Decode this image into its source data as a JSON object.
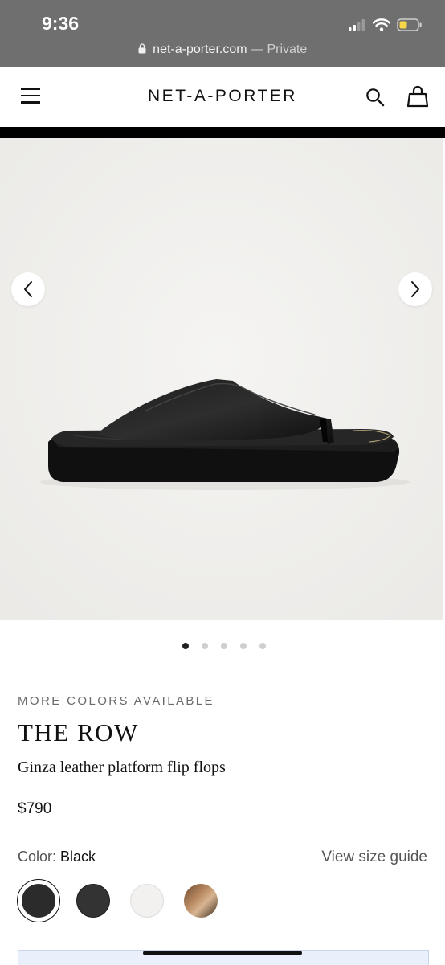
{
  "status_bar": {
    "time": "9:36",
    "url": "net-a-porter.com",
    "private_label": "— Private"
  },
  "header": {
    "brand": "NET-A-PORTER"
  },
  "icons": {
    "menu": "hamburger-menu-icon",
    "search": "search-icon",
    "bag": "shopping-bag-icon",
    "prev": "chevron-left-icon",
    "next": "chevron-right-icon",
    "lock": "lock-icon"
  },
  "gallery": {
    "image_count": 5,
    "active_index": 0
  },
  "product": {
    "more_colors": "MORE COLORS AVAILABLE",
    "designer": "THE ROW",
    "name": "Ginza leather platform flip flops",
    "price": "$790",
    "color_label": "Color:",
    "color_value": "Black",
    "size_guide": "View size guide",
    "swatches": [
      {
        "name": "Black",
        "color": "#2b2b2b",
        "selected": true
      },
      {
        "name": "Dark grey",
        "color": "#333333",
        "selected": false
      },
      {
        "name": "White",
        "color": "#f2f1ef",
        "selected": false
      },
      {
        "name": "Tan",
        "color": "#b98a62",
        "selected": false
      }
    ]
  }
}
